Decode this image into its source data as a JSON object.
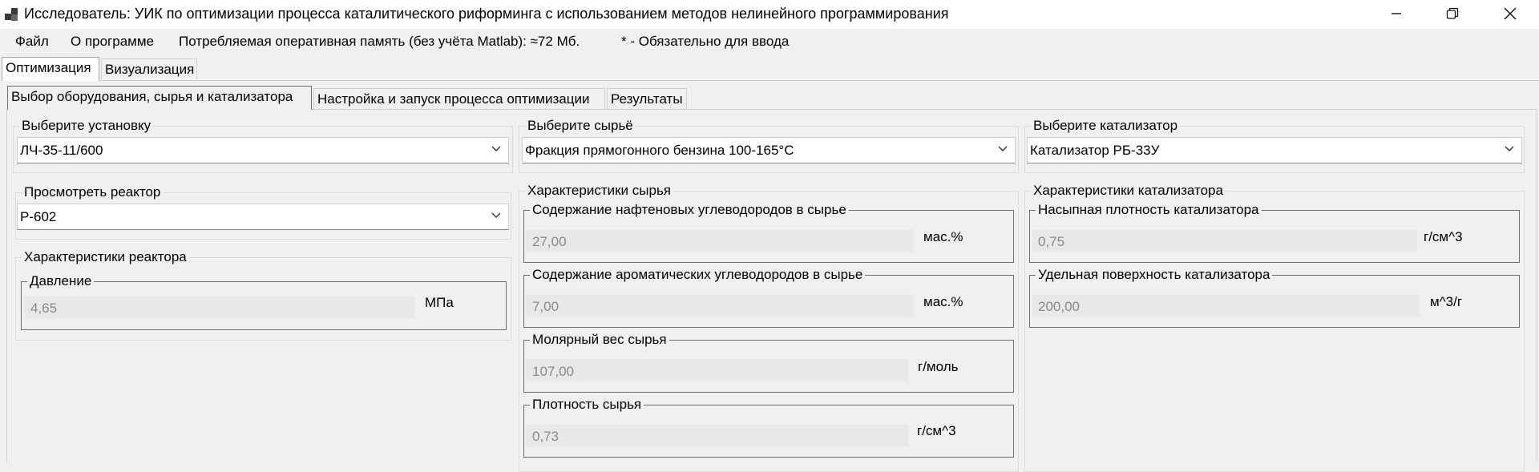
{
  "window": {
    "title": "Исследователь: УИК по оптимизации процесса каталитического риформинга с использованием методов нелинейного программирования",
    "icons": [
      "app-icon",
      "minimize-icon",
      "restore-icon",
      "close-icon"
    ]
  },
  "menu": {
    "file": "Файл",
    "about": "О программе",
    "memory": "Потребляемая оперативная память (без учёта Matlab): ≈72 Мб.",
    "required_note": "* - Обязательно для ввода"
  },
  "tabs": {
    "top": [
      {
        "label": "Оптимизация",
        "active": true
      },
      {
        "label": "Визуализация",
        "active": false
      }
    ],
    "sub": [
      {
        "label": "Выбор оборудования, сырья и катализатора",
        "active": true
      },
      {
        "label": "Настройка и запуск процесса оптимизации",
        "active": false
      },
      {
        "label": "Результаты",
        "active": false
      }
    ]
  },
  "installation": {
    "legend": "Выберите установку",
    "selected": "ЛЧ-35-11/600"
  },
  "feed": {
    "legend": "Выберите сырьё",
    "selected": "Фракция прямогонного бензина 100-165°С"
  },
  "catalyst": {
    "legend": "Выберите катализатор",
    "selected": "Катализатор РБ-33У"
  },
  "reactor_view": {
    "legend": "Просмотреть реактор",
    "selected": "Р-602"
  },
  "reactor_chars": {
    "legend": "Характеристики реактора",
    "pressure": {
      "label": "Давление",
      "value": "4,65",
      "unit": "МПа"
    }
  },
  "feed_chars": {
    "legend": "Характеристики сырья",
    "naphthenes": {
      "label": "Содержание нафтеновых углеводородов в сырье",
      "value": "27,00",
      "unit": "мас.%"
    },
    "aromatics": {
      "label": "Содержание ароматических углеводородов в сырье",
      "value": "7,00",
      "unit": "мас.%"
    },
    "molar_weight": {
      "label": "Молярный вес сырья",
      "value": "107,00",
      "unit": "г/моль"
    },
    "density": {
      "label": "Плотность сырья",
      "value": "0,73",
      "unit": "г/см^3"
    }
  },
  "catalyst_chars": {
    "legend": "Характеристики катализатора",
    "bulk_density": {
      "label": "Насыпная плотность катализатора",
      "value": "0,75",
      "unit": "г/см^3"
    },
    "surface_area": {
      "label": "Удельная поверхность катализатора",
      "value": "200,00",
      "unit": "м^3/г"
    }
  }
}
